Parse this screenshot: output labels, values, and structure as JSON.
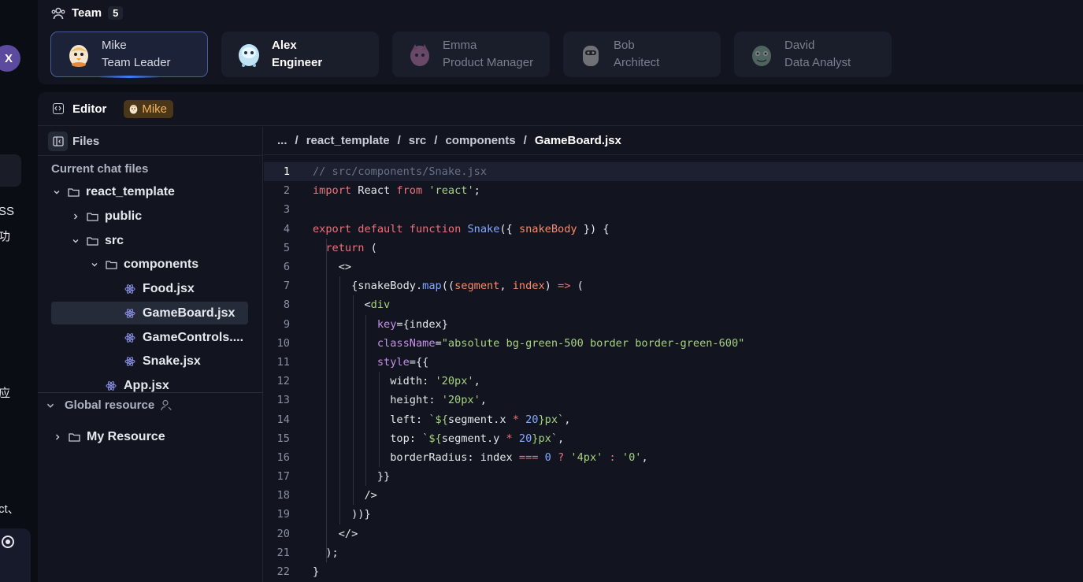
{
  "edge": {
    "avatar_letter": "X",
    "snippets": [
      "SS",
      "功",
      "应",
      "ct、"
    ]
  },
  "team": {
    "title": "Team",
    "count": "5",
    "members": [
      {
        "name": "Mike",
        "role": "Team Leader",
        "state": "active",
        "avatar": "egg-chick-avatar"
      },
      {
        "name": "Alex",
        "role": "Engineer",
        "state": "bright",
        "avatar": "blue-blob-avatar"
      },
      {
        "name": "Emma",
        "role": "Product Manager",
        "state": "dim",
        "avatar": "pink-creature-avatar"
      },
      {
        "name": "Bob",
        "role": "Architect",
        "state": "dim",
        "avatar": "dark-robot-avatar"
      },
      {
        "name": "David",
        "role": "Data Analyst",
        "state": "dim",
        "avatar": "green-monster-avatar"
      }
    ]
  },
  "editor": {
    "title": "Editor",
    "agent_badge": "Mike"
  },
  "files": {
    "title": "Files",
    "section": "Current chat files",
    "tree": [
      {
        "label": "react_template",
        "type": "folder",
        "open": true,
        "level": 0
      },
      {
        "label": "public",
        "type": "folder",
        "open": false,
        "level": 1
      },
      {
        "label": "src",
        "type": "folder",
        "open": true,
        "level": 1
      },
      {
        "label": "components",
        "type": "folder",
        "open": true,
        "level": 2
      },
      {
        "label": "Food.jsx",
        "type": "file",
        "level": 3
      },
      {
        "label": "GameBoard.jsx",
        "type": "file",
        "level": 3,
        "selected": true
      },
      {
        "label": "GameControls....",
        "type": "file",
        "level": 3
      },
      {
        "label": "Snake.jsx",
        "type": "file",
        "level": 3
      },
      {
        "label": "App.jsx",
        "type": "file",
        "level": 2
      }
    ],
    "global_resource": "Global resource",
    "my_resource": "My Resource"
  },
  "breadcrumb": [
    "...",
    "react_template",
    "src",
    "components",
    "GameBoard.jsx"
  ],
  "code": {
    "current_line": 1,
    "lines": [
      [
        [
          "// src/components/Snake.jsx",
          "com"
        ]
      ],
      [
        [
          "import",
          "kw"
        ],
        [
          " React ",
          "def"
        ],
        [
          "from",
          "kw"
        ],
        [
          " ",
          "def"
        ],
        [
          "'react'",
          "str"
        ],
        [
          ";",
          "def"
        ]
      ],
      [],
      [
        [
          "export",
          "kw"
        ],
        [
          " ",
          "def"
        ],
        [
          "default",
          "kw"
        ],
        [
          " ",
          "def"
        ],
        [
          "function",
          "kw"
        ],
        [
          " ",
          "def"
        ],
        [
          "Snake",
          "fn"
        ],
        [
          "({ ",
          "def"
        ],
        [
          "snakeBody",
          "par"
        ],
        [
          " }) {",
          "def"
        ]
      ],
      [
        [
          "  ",
          "def"
        ],
        [
          "return",
          "kw"
        ],
        [
          " (",
          "def"
        ]
      ],
      [
        [
          "    <>",
          "def"
        ]
      ],
      [
        [
          "      {snakeBody.",
          "def"
        ],
        [
          "map",
          "fn"
        ],
        [
          "((",
          "def"
        ],
        [
          "segment",
          "par"
        ],
        [
          ", ",
          "def"
        ],
        [
          "index",
          "par"
        ],
        [
          ") ",
          "def"
        ],
        [
          "=>",
          "op"
        ],
        [
          " (",
          "def"
        ]
      ],
      [
        [
          "        <",
          "def"
        ],
        [
          "div",
          "tag"
        ]
      ],
      [
        [
          "          ",
          "def"
        ],
        [
          "key",
          "attr"
        ],
        [
          "={index}",
          "def"
        ]
      ],
      [
        [
          "          ",
          "def"
        ],
        [
          "className",
          "attr"
        ],
        [
          "=",
          "def"
        ],
        [
          "\"absolute bg-green-500 border border-green-600\"",
          "str"
        ]
      ],
      [
        [
          "          ",
          "def"
        ],
        [
          "style",
          "attr"
        ],
        [
          "={{",
          "def"
        ]
      ],
      [
        [
          "            width: ",
          "def"
        ],
        [
          "'20px'",
          "str"
        ],
        [
          ",",
          "def"
        ]
      ],
      [
        [
          "            height: ",
          "def"
        ],
        [
          "'20px'",
          "str"
        ],
        [
          ",",
          "def"
        ]
      ],
      [
        [
          "            left: ",
          "def"
        ],
        [
          "`${",
          "str"
        ],
        [
          "segment.x ",
          "def"
        ],
        [
          "*",
          "op"
        ],
        [
          " ",
          "def"
        ],
        [
          "20",
          "num"
        ],
        [
          "}px`",
          "str"
        ],
        [
          ",",
          "def"
        ]
      ],
      [
        [
          "            top: ",
          "def"
        ],
        [
          "`${",
          "str"
        ],
        [
          "segment.y ",
          "def"
        ],
        [
          "*",
          "op"
        ],
        [
          " ",
          "def"
        ],
        [
          "20",
          "num"
        ],
        [
          "}px`",
          "str"
        ],
        [
          ",",
          "def"
        ]
      ],
      [
        [
          "            borderRadius: index ",
          "def"
        ],
        [
          "===",
          "op"
        ],
        [
          " ",
          "def"
        ],
        [
          "0",
          "num"
        ],
        [
          " ",
          "def"
        ],
        [
          "?",
          "op"
        ],
        [
          " ",
          "def"
        ],
        [
          "'4px'",
          "str"
        ],
        [
          " ",
          "def"
        ],
        [
          ":",
          "op"
        ],
        [
          " ",
          "def"
        ],
        [
          "'0'",
          "str"
        ],
        [
          ",",
          "def"
        ]
      ],
      [
        [
          "          }}",
          "def"
        ]
      ],
      [
        [
          "        />",
          "def"
        ]
      ],
      [
        [
          "      ))}",
          "def"
        ]
      ],
      [
        [
          "    </>",
          "def"
        ]
      ],
      [
        [
          "  );",
          "def"
        ]
      ],
      [
        [
          "}",
          "def"
        ]
      ]
    ]
  },
  "colors": {
    "background": "#0b0d14",
    "panel": "#121520",
    "accent": "#3d7cff",
    "badge_bg": "#4a3618",
    "badge_text": "#f2b45c"
  }
}
